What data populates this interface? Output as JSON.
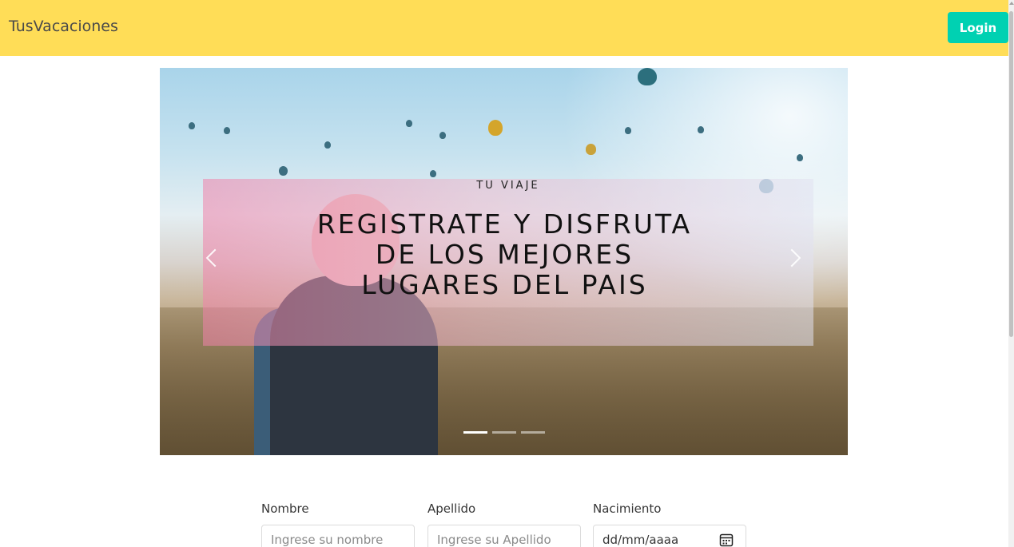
{
  "navbar": {
    "brand": "TusVacaciones",
    "login_label": "Login",
    "background": "#ffdd57",
    "login_color": "#00d1b2"
  },
  "carousel": {
    "kicker": "TU VIAJE",
    "title": "REGISTRATE Y DISFRUTA DE LOS MEJORES LUGARES DEL PAIS",
    "prev_icon": "chevron-left-icon",
    "next_icon": "chevron-right-icon",
    "active_slide": 1,
    "slide_count": 3
  },
  "form": {
    "nombre": {
      "label": "Nombre",
      "placeholder": "Ingrese su nombre"
    },
    "apellido": {
      "label": "Apellido",
      "placeholder": "Ingrese su Apellido"
    },
    "nacimiento": {
      "label": "Nacimiento",
      "value": "dd/mm/aaaa",
      "icon": "calendar-icon"
    }
  }
}
